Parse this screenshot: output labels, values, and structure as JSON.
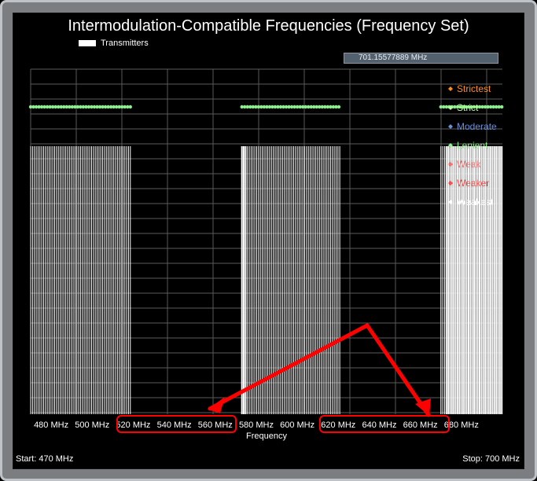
{
  "window": {
    "title": "Intermodulation-Compatible Frequencies (Frequency Set)",
    "legend_label": "Transmitters",
    "readout": "701.15577889 MHz",
    "start_label": "Start: 470 MHz",
    "stop_label": "Stop: 700 MHz"
  },
  "colors": {
    "background": "#000000",
    "frame": "#7b7d80",
    "readout_bg": "#53606d",
    "transmitter_lines": "#ffffff",
    "lenient_markers": "#90ee90",
    "annotation": "#ff0000"
  },
  "chart_data": {
    "type": "scatter",
    "title": "Intermodulation-Compatible Frequencies (Frequency Set)",
    "xlabel": "Frequency",
    "ylabel": "",
    "xlim": [
      470,
      700
    ],
    "x_ticks": [
      "480 MHz",
      "500 MHz",
      "520 MHz",
      "540 MHz",
      "560 MHz",
      "580 MHz",
      "600 MHz",
      "620 MHz",
      "640 MHz",
      "660 MHz",
      "680 MHz"
    ],
    "grid": true,
    "legend_position": "right",
    "legend": [
      {
        "name": "Strictest",
        "color": "#ff8c1a"
      },
      {
        "name": "Strict",
        "color": "#b7ff9a"
      },
      {
        "name": "Moderate",
        "color": "#6a8fd8"
      },
      {
        "name": "Lenient",
        "color": "#90ee90"
      },
      {
        "name": "Weak",
        "color": "#ff6a6a"
      },
      {
        "name": "Weaker",
        "color": "#ff4b4b"
      },
      {
        "name": "Weakest",
        "color": "#ffffff"
      }
    ],
    "transmitter_ranges_mhz": [
      [
        470,
        519
      ],
      [
        573,
        621
      ],
      [
        670,
        700
      ]
    ],
    "lenient_marker_ranges_mhz": [
      [
        470,
        519
      ],
      [
        573,
        621
      ],
      [
        670,
        700
      ]
    ],
    "annotations": [
      {
        "type": "highlight",
        "x_range": [
          520,
          569
        ],
        "label": "520 MHz to 560 MHz gap"
      },
      {
        "type": "highlight",
        "x_range": [
          616,
          676
        ],
        "label": "620 MHz to 680 MHz region"
      }
    ]
  }
}
